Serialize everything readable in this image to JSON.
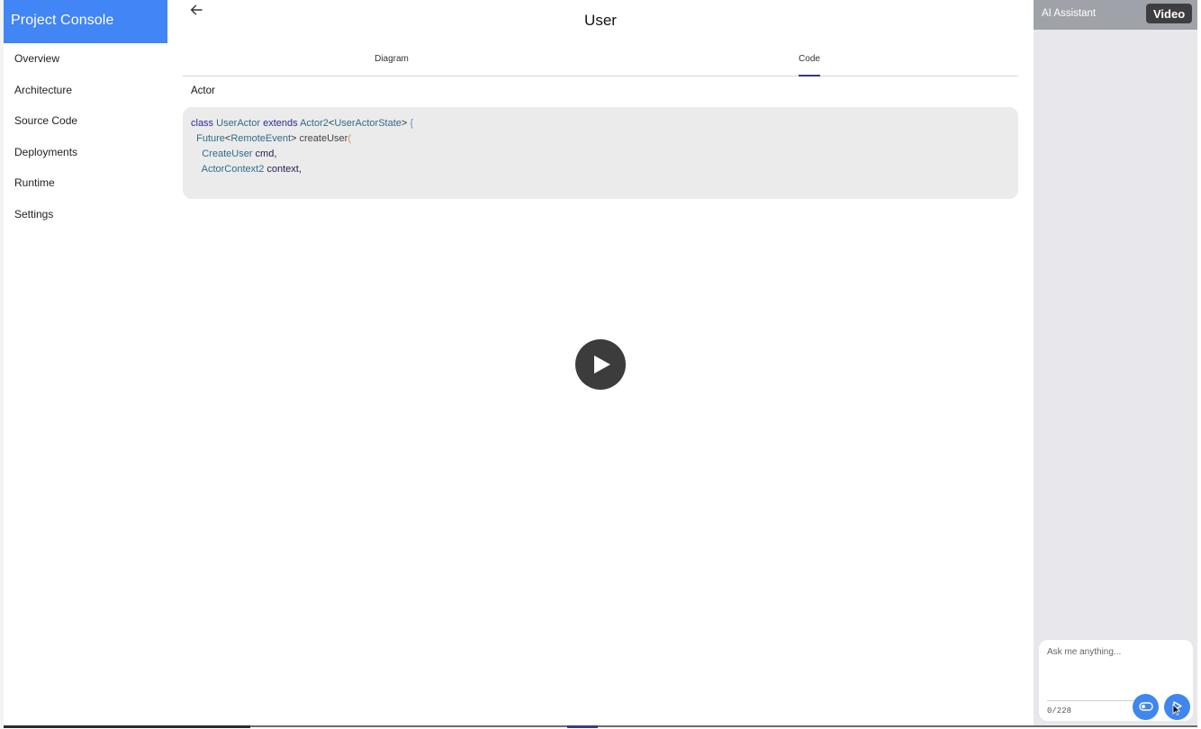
{
  "sidebar": {
    "brand": "Project Console",
    "brand_color": "#4285f4",
    "items": [
      {
        "label": "Overview"
      },
      {
        "label": "Architecture"
      },
      {
        "label": "Source Code"
      },
      {
        "label": "Deployments"
      },
      {
        "label": "Runtime"
      },
      {
        "label": "Settings"
      }
    ]
  },
  "main": {
    "back_icon": "arrow-left-icon",
    "title": "User",
    "tabs": [
      {
        "label": "Diagram",
        "active": false
      },
      {
        "label": "Code",
        "active": true
      }
    ],
    "section_label": "Actor",
    "code": {
      "line1": {
        "kw1": "class",
        "t1": "UserActor",
        "kw2": "extends",
        "t2": "Actor2",
        "p1": "<",
        "t3": "UserActorState",
        "p2": ">",
        "b": " {"
      },
      "line2": {
        "t1": "Future",
        "p1": "<",
        "t2": "RemoteEvent",
        "p2": ">",
        "fn": "createUser",
        "b": "("
      },
      "line3": {
        "t1": "CreateUser",
        "id": "cmd,"
      },
      "line4": {
        "t1": "ActorContext2",
        "id": "context,"
      }
    },
    "play_icon": "play-icon"
  },
  "assistant": {
    "title": "AI Assistant",
    "video_label": "Video",
    "input_placeholder": "Ask me anything...",
    "input_value": "",
    "char_count": "0/228",
    "toggle_icon": "toggle-icon",
    "send_icon": "send-icon",
    "accent_color": "#3f86ee"
  }
}
